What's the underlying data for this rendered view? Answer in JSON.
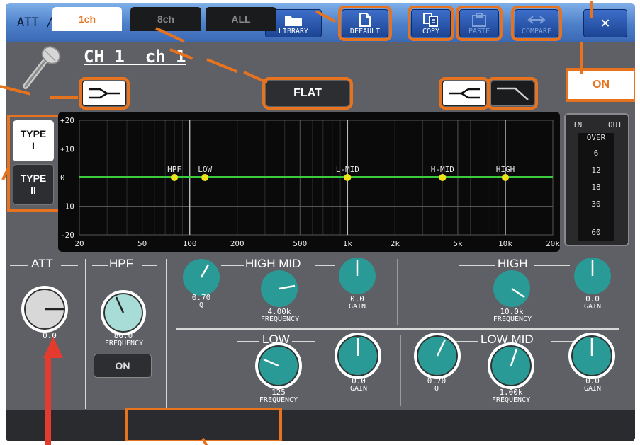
{
  "window": {
    "title": "ATT / HPF / EQ"
  },
  "toolbar": {
    "library_label": "LIBRARY",
    "default_label": "DEFAULT",
    "copy_label": "COPY",
    "paste_label": "PASTE",
    "compare_label": "COMPARE",
    "close_glyph": "✕"
  },
  "channel": {
    "name": "CH 1  ch 1"
  },
  "eq": {
    "flat_label": "FLAT",
    "on_label": "ON",
    "type1_label": "TYPE\nI",
    "type2_label": "TYPE\nII",
    "selected_type": "TYPE I"
  },
  "graph": {
    "y_ticks": [
      "+20",
      "+10",
      "0",
      "-10",
      "-20"
    ],
    "x_ticks": [
      "20",
      "50",
      "100",
      "200",
      "500",
      "1k",
      "2k",
      "5k",
      "10k",
      "20k"
    ],
    "band_markers": [
      "HPF",
      "LOW",
      "L-MID",
      "H-MID",
      "HIGH"
    ]
  },
  "meter": {
    "in_label": "IN",
    "out_label": "OUT",
    "scale": [
      "OVER",
      "6",
      "12",
      "18",
      "30",
      "60"
    ]
  },
  "att": {
    "label": "ATT",
    "value": "0.0"
  },
  "hpf": {
    "label": "HPF",
    "freq_value": "80.0",
    "freq_caption": "FREQUENCY",
    "on_label": "ON"
  },
  "high_mid": {
    "label": "HIGH MID",
    "q_value": "0.70",
    "q_caption": "Q",
    "freq_value": "4.00k",
    "freq_caption": "FREQUENCY",
    "gain_value": "0.0",
    "gain_caption": "GAIN"
  },
  "high": {
    "label": "HIGH",
    "freq_value": "10.0k",
    "freq_caption": "FREQUENCY",
    "gain_value": "0.0",
    "gain_caption": "GAIN"
  },
  "low": {
    "label": "LOW",
    "freq_value": "125",
    "freq_caption": "FREQUENCY",
    "gain_value": "0.0",
    "gain_caption": "GAIN"
  },
  "low_mid": {
    "label": "LOW MID",
    "q_value": "0.70",
    "q_caption": "Q",
    "freq_value": "1.00k",
    "freq_caption": "FREQUENCY",
    "gain_value": "0.0",
    "gain_caption": "GAIN"
  },
  "tabs": {
    "tab1": "1ch",
    "tab8": "8ch",
    "taball": "ALL",
    "selected": "1ch"
  },
  "colors": {
    "accent_orange": "#e8731f",
    "knob_teal": "#2a9a96",
    "titlebar_blue": "#4d7fc9",
    "marker_yellow": "#f2e21a",
    "flat_line_green": "#3ccb3c"
  }
}
